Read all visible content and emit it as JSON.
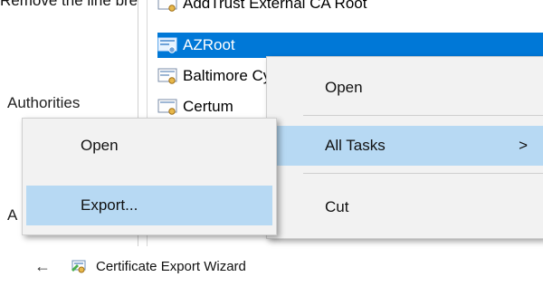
{
  "document": {
    "top_text": "Remove the line breaks and configure as one single line"
  },
  "left_labels": {
    "authorities": "Authorities",
    "partial_a": "A"
  },
  "tree": {
    "items": [
      {
        "label": "AddTrust External CA Root",
        "selected": false
      },
      {
        "label": "AZRoot",
        "selected": true
      },
      {
        "label": "Baltimore CyberTrust Root",
        "selected": false
      },
      {
        "label": "Certum",
        "selected": false
      }
    ]
  },
  "context_menu_right": {
    "items": [
      {
        "label": "Open"
      },
      {
        "label": "All Tasks",
        "submenu_arrow": ">"
      },
      {
        "label": "Cut"
      }
    ]
  },
  "context_menu_left": {
    "items": [
      {
        "label": "Open",
        "highlighted": false
      },
      {
        "label": "Export...",
        "highlighted": true
      }
    ]
  },
  "wizard_header": {
    "back_arrow": "←",
    "title": "Certificate Export Wizard"
  },
  "colors": {
    "selection": "#0078d7",
    "menu_highlight": "#b7d9f3",
    "menu_background": "#f2f2f2"
  }
}
